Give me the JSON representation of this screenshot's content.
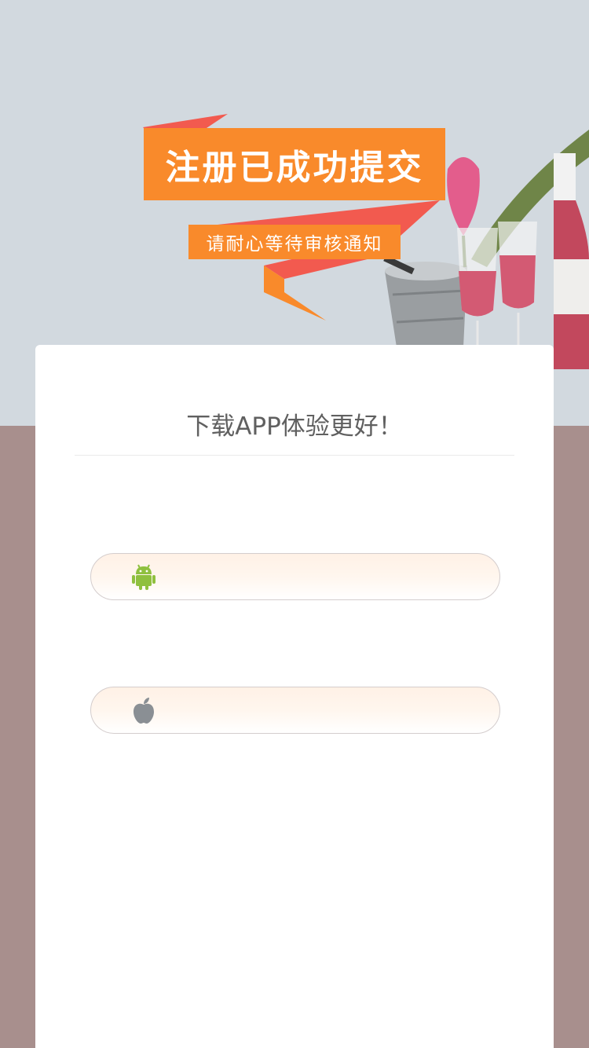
{
  "banner": {
    "title": "注册已成功提交",
    "subtitle": "请耐心等待审核通知"
  },
  "download": {
    "heading": "下载APP体验更好！",
    "buttons": [
      {
        "platform": "android",
        "icon": "android-icon",
        "icon_color": "#8fc03f"
      },
      {
        "platform": "ios",
        "icon": "apple-icon",
        "icon_color": "#8a8f94"
      }
    ]
  },
  "colors": {
    "hero_bg": "#d2d9df",
    "page_bg": "#a88f8d",
    "ribbon_orange": "#f98a2b",
    "ribbon_red": "#f25a4f"
  }
}
